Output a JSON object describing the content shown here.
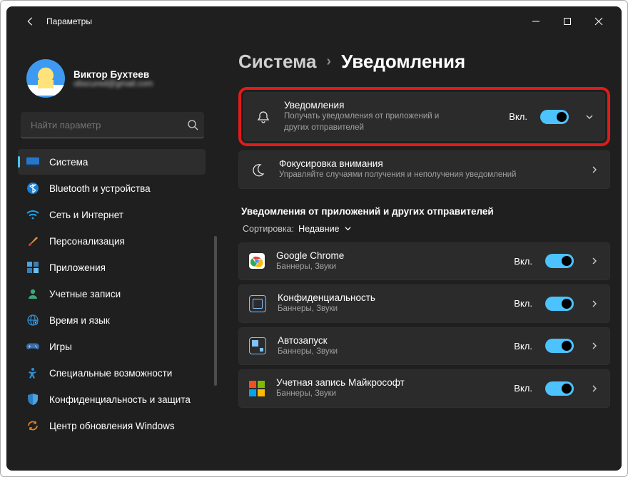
{
  "titlebar": {
    "title": "Параметры"
  },
  "profile": {
    "name": "Виктор Бухтеев",
    "email": "obscured@gmail.com"
  },
  "search": {
    "placeholder": "Найти параметр"
  },
  "nav": [
    {
      "label": "Система",
      "icon": "system",
      "active": true
    },
    {
      "label": "Bluetooth и устройства",
      "icon": "bluetooth"
    },
    {
      "label": "Сеть и Интернет",
      "icon": "wifi"
    },
    {
      "label": "Персонализация",
      "icon": "brush"
    },
    {
      "label": "Приложения",
      "icon": "apps"
    },
    {
      "label": "Учетные записи",
      "icon": "account"
    },
    {
      "label": "Время и язык",
      "icon": "globe"
    },
    {
      "label": "Игры",
      "icon": "games"
    },
    {
      "label": "Специальные возможности",
      "icon": "access"
    },
    {
      "label": "Конфиденциальность и защита",
      "icon": "shield"
    },
    {
      "label": "Центр обновления Windows",
      "icon": "update"
    }
  ],
  "breadcrumb": {
    "root": "Система",
    "page": "Уведомления"
  },
  "notif": {
    "title": "Уведомления",
    "sub": "Получать уведомления от приложений и других отправителей",
    "state": "Вкл."
  },
  "focus": {
    "title": "Фокусировка внимания",
    "sub": "Управляйте случаями получения и неполучения уведомлений"
  },
  "section": "Уведомления от приложений и других отправителей",
  "sort": {
    "label": "Сортировка:",
    "value": "Недавние"
  },
  "apps": [
    {
      "title": "Google Chrome",
      "sub": "Баннеры, Звуки",
      "state": "Вкл.",
      "icon": "chrome"
    },
    {
      "title": "Конфиденциальность",
      "sub": "Баннеры, Звуки",
      "state": "Вкл.",
      "icon": "privacy"
    },
    {
      "title": "Автозапуск",
      "sub": "Баннеры, Звуки",
      "state": "Вкл.",
      "icon": "autorun"
    },
    {
      "title": "Учетная запись Майкрософт",
      "sub": "Баннеры, Звуки",
      "state": "Вкл.",
      "icon": "ms"
    }
  ]
}
